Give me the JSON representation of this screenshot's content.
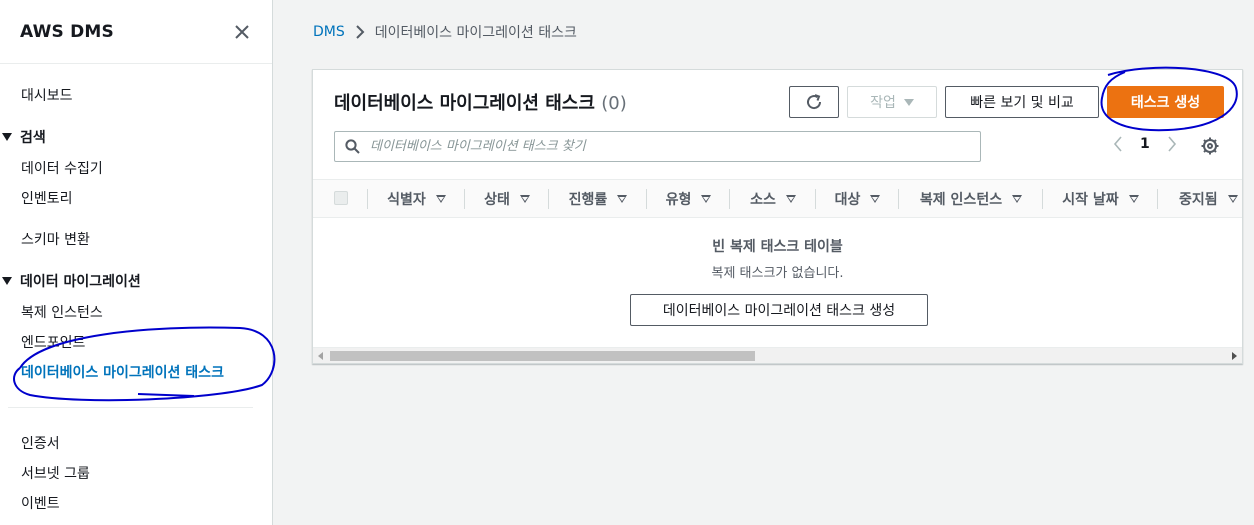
{
  "sidebar": {
    "title": "AWS DMS",
    "items": {
      "dashboard": "대시보드",
      "discover": "검색",
      "data_collectors": "데이터 수집기",
      "inventory": "인벤토리",
      "schema_conversion": "스키마 변환",
      "data_migration": "데이터 마이그레이션",
      "replication_instances": "복제 인스턴스",
      "endpoints": "엔드포인트",
      "migration_tasks": "데이터베이스 마이그레이션 태스크",
      "certificates": "인증서",
      "subnet_groups": "서브넷 그룹",
      "events": "이벤트"
    }
  },
  "breadcrumb": {
    "root": "DMS",
    "current": "데이터베이스 마이그레이션 태스크"
  },
  "panel": {
    "title": "데이터베이스 마이그레이션 태스크",
    "count": "(0)",
    "actions_label": "작업",
    "quick_compare_label": "빠른 보기 및 비교",
    "create_label": "태스크 생성",
    "search_placeholder": "데이터베이스 마이그레이션 태스크 찾기",
    "page": "1",
    "columns": [
      "식별자",
      "상태",
      "진행률",
      "유형",
      "소스",
      "대상",
      "복제 인스턴스",
      "시작 날짜",
      "중지됨"
    ],
    "empty_title": "빈 복제 태스크 테이블",
    "empty_subtitle": "복제 태스크가 없습니다.",
    "empty_create_label": "데이터베이스 마이그레이션 태스크 생성"
  },
  "colors": {
    "accent": "#ec7211",
    "link": "#0073bb",
    "annotation": "#0000cc"
  }
}
